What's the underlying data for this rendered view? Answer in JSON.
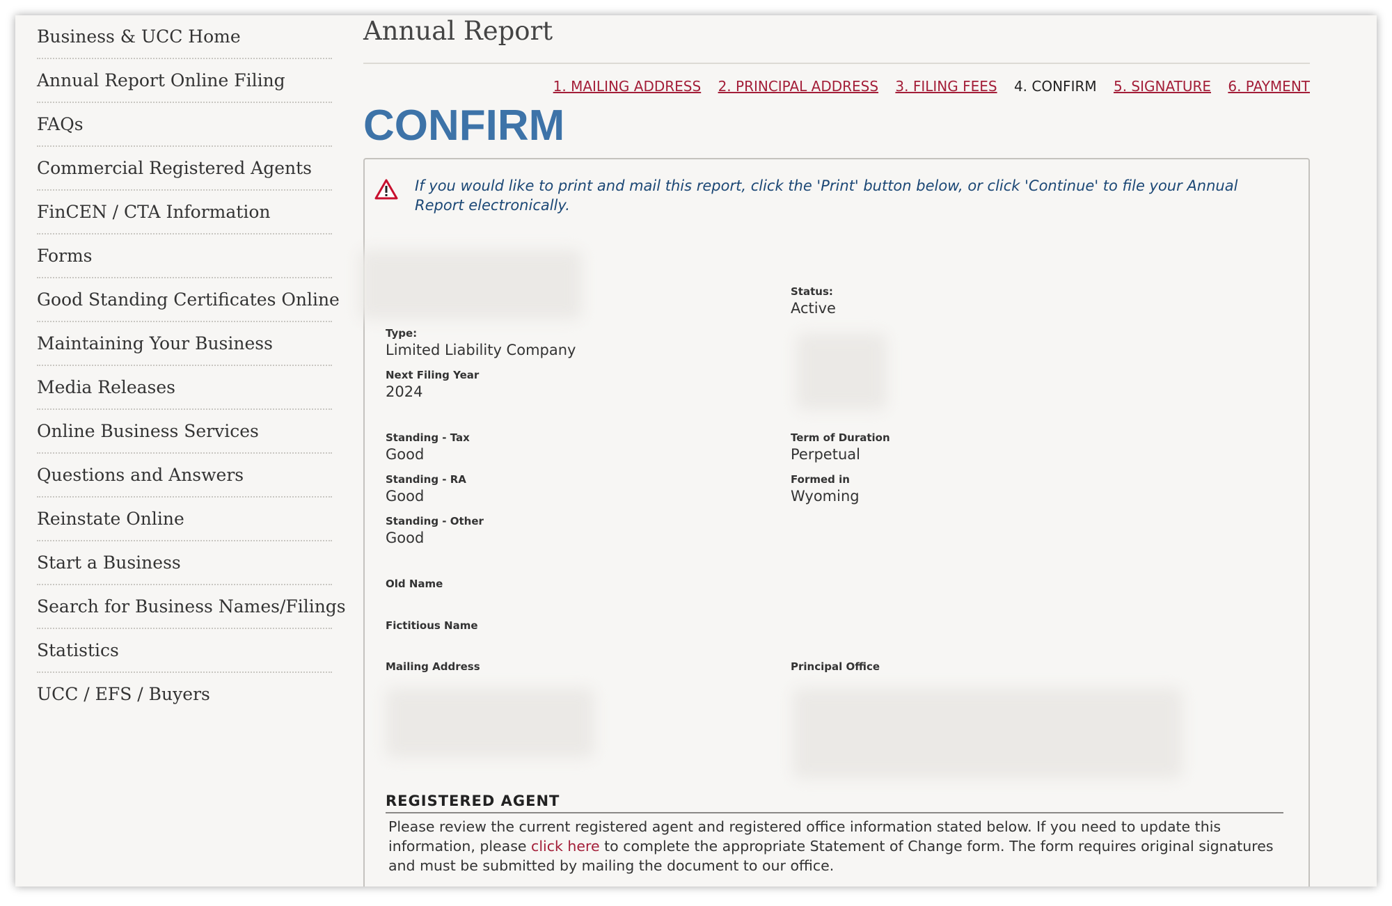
{
  "sidebar": {
    "items": [
      {
        "label": "Business & UCC Home"
      },
      {
        "label": "Annual Report Online Filing"
      },
      {
        "label": "FAQs"
      },
      {
        "label": "Commercial Registered Agents"
      },
      {
        "label": "FinCEN / CTA Information"
      },
      {
        "label": "Forms"
      },
      {
        "label": "Good Standing Certificates Online"
      },
      {
        "label": "Maintaining Your Business"
      },
      {
        "label": "Media Releases"
      },
      {
        "label": "Online Business Services"
      },
      {
        "label": "Questions and Answers"
      },
      {
        "label": "Reinstate Online"
      },
      {
        "label": "Start a Business"
      },
      {
        "label": "Search for Business Names/Filings"
      },
      {
        "label": "Statistics"
      },
      {
        "label": "UCC / EFS / Buyers"
      }
    ]
  },
  "page": {
    "title": "Annual Report",
    "heading": "CONFIRM"
  },
  "steps": [
    {
      "label": "1. MAILING ADDRESS",
      "state": "link"
    },
    {
      "label": "2. PRINCIPAL ADDRESS",
      "state": "link"
    },
    {
      "label": "3. FILING FEES",
      "state": "link"
    },
    {
      "label": "4. CONFIRM",
      "state": "current"
    },
    {
      "label": "5. SIGNATURE",
      "state": "link"
    },
    {
      "label": "6. PAYMENT",
      "state": "link"
    }
  ],
  "alert": {
    "icon": "warning-triangle-icon",
    "text": "If you would like to print and mail this report, click the 'Print' button below, or click 'Continue' to file your Annual Report electronically."
  },
  "fields": {
    "status": {
      "label": "Status:",
      "value": "Active"
    },
    "type": {
      "label": "Type:",
      "value": "Limited Liability Company"
    },
    "next_filing_year": {
      "label": "Next Filing Year",
      "value": "2024"
    },
    "standing_tax": {
      "label": "Standing - Tax",
      "value": "Good"
    },
    "term_of_duration": {
      "label": "Term of Duration",
      "value": "Perpetual"
    },
    "standing_ra": {
      "label": "Standing - RA",
      "value": "Good"
    },
    "formed_in": {
      "label": "Formed in",
      "value": "Wyoming"
    },
    "standing_other": {
      "label": "Standing - Other",
      "value": "Good"
    },
    "old_name": {
      "label": "Old Name"
    },
    "fictitious_name": {
      "label": "Fictitious Name"
    },
    "mailing_address": {
      "label": "Mailing Address"
    },
    "principal_office": {
      "label": "Principal Office"
    }
  },
  "registered_agent": {
    "heading": "REGISTERED AGENT",
    "text_before": "Please review the current registered agent and registered office information stated below. If you need to update this information, please ",
    "link": "click here",
    "text_after": " to complete the appropriate Statement of Change form. The form requires original signatures and must be submitted by mailing the document to our office."
  },
  "colors": {
    "link": "#a31e38",
    "heading_blue": "#3d73a8",
    "alert_text": "#1b4775",
    "alert_icon": "#c8102e"
  }
}
